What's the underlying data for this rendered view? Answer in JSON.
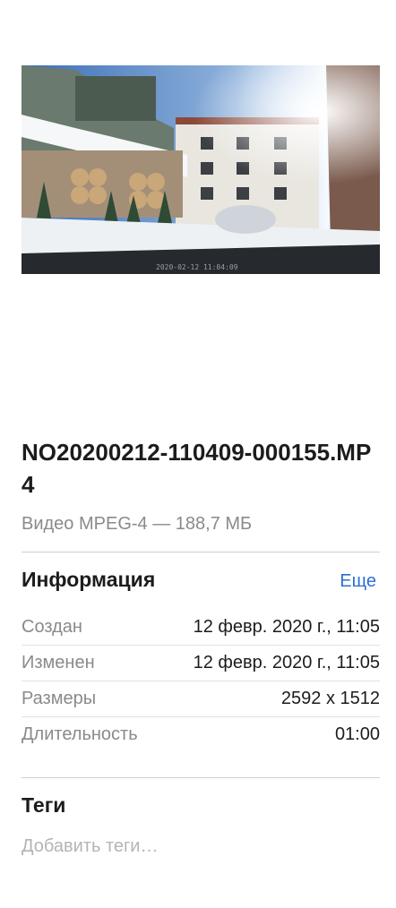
{
  "file": {
    "name": "NO20200212-110409-000155.MP4",
    "subtitle": "Видео MPEG-4 — 188,7 МБ"
  },
  "preview": {
    "watermark": "2020-02-12 11:04:09"
  },
  "info": {
    "title": "Информация",
    "more_label": "Еще",
    "rows": [
      {
        "key": "Создан",
        "value": "12 февр. 2020 г., 11:05"
      },
      {
        "key": "Изменен",
        "value": "12 февр. 2020 г., 11:05"
      },
      {
        "key": "Размеры",
        "value": "2592 x 1512"
      },
      {
        "key": "Длительность",
        "value": "01:00"
      }
    ]
  },
  "tags": {
    "title": "Теги",
    "placeholder": "Добавить теги…"
  },
  "colors": {
    "accent": "#2a6fd1",
    "secondary_text": "#8a8a8e"
  }
}
